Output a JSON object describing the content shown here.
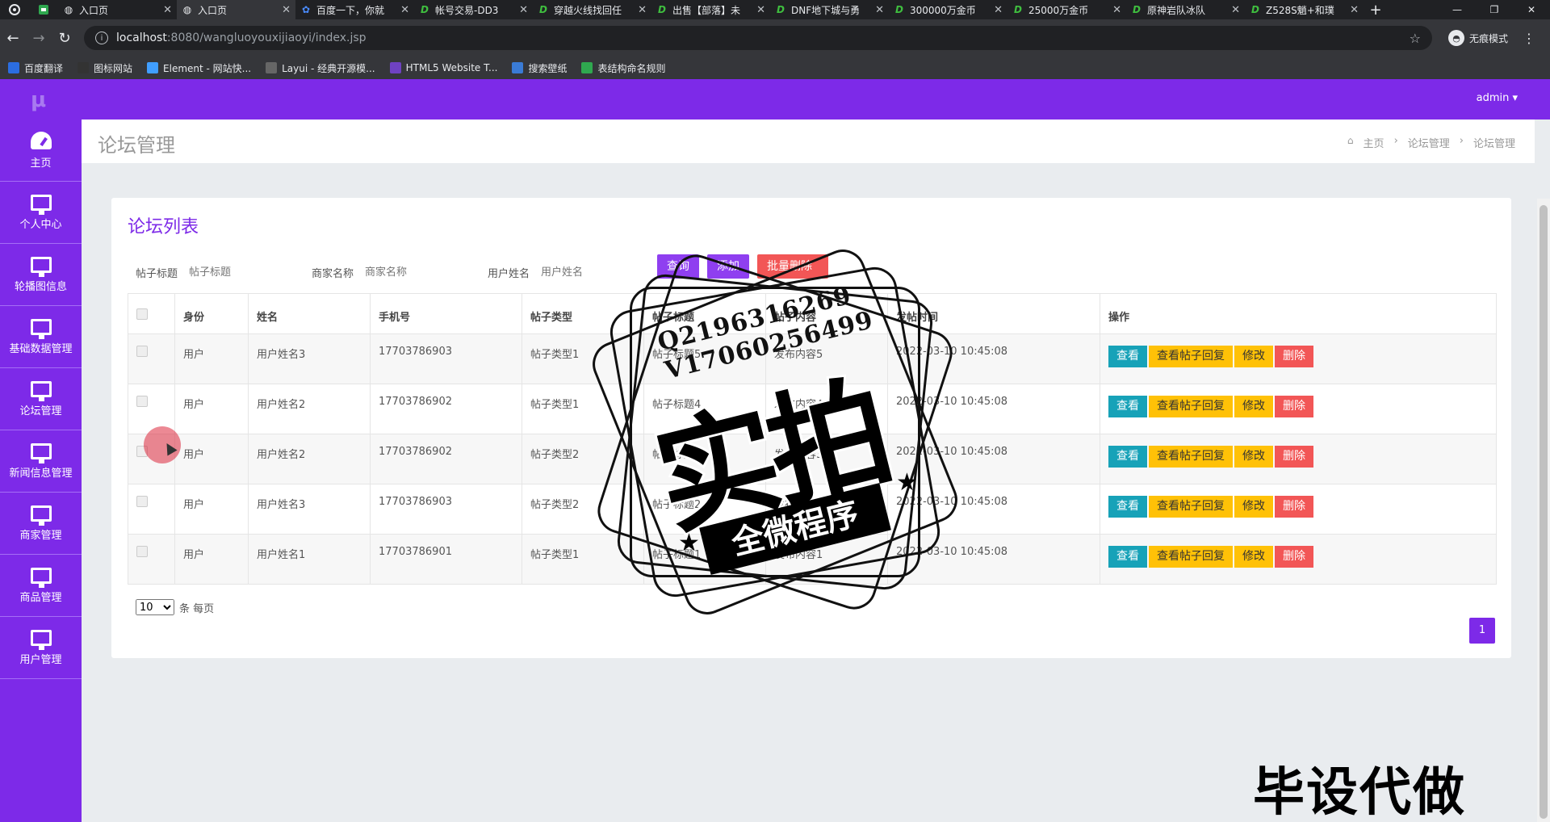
{
  "browser": {
    "tabs": [
      {
        "favicon": "globe-icon",
        "title": "入口页",
        "active": false
      },
      {
        "favicon": "globe-icon",
        "title": "入口页",
        "active": true
      },
      {
        "favicon": "paw-icon",
        "title": "百度一下，你就",
        "active": false
      },
      {
        "favicon": "d-icon",
        "title": "帐号交易-DD3",
        "active": false
      },
      {
        "favicon": "d-icon",
        "title": "穿越火线找回任",
        "active": false
      },
      {
        "favicon": "d-icon",
        "title": "出售【部落】未",
        "active": false
      },
      {
        "favicon": "d-icon",
        "title": "DNF地下城与勇",
        "active": false
      },
      {
        "favicon": "d-icon",
        "title": "300000万金币",
        "active": false
      },
      {
        "favicon": "d-icon",
        "title": "25000万金币",
        "active": false
      },
      {
        "favicon": "d-icon",
        "title": "原神岩队冰队",
        "active": false
      },
      {
        "favicon": "d-icon",
        "title": "Z528S魈+和璞",
        "active": false
      }
    ],
    "url_host": "localhost",
    "url_path": ":8080/wangluoyouxijiaoyi/index.jsp",
    "profile_label": "无痕模式",
    "bookmarks": [
      {
        "label": "百度翻译",
        "color": "#2b6de0"
      },
      {
        "label": "图标网站",
        "color": "#333333"
      },
      {
        "label": "Element - 网站快...",
        "color": "#409eff"
      },
      {
        "label": "Layui - 经典开源模...",
        "color": "#666666"
      },
      {
        "label": "HTML5 Website T...",
        "color": "#6f42c1"
      },
      {
        "label": "搜索壁纸",
        "color": "#3a7bd5"
      },
      {
        "label": "表结构命名规则",
        "color": "#2fa84f"
      }
    ]
  },
  "app": {
    "logo": "μ",
    "user": "admin ▾",
    "sidebar": [
      {
        "label": "主页",
        "icon": "dashboard-icon"
      },
      {
        "label": "个人中心",
        "icon": "monitor-icon"
      },
      {
        "label": "轮播图信息",
        "icon": "monitor-icon"
      },
      {
        "label": "基础数据管理",
        "icon": "monitor-icon"
      },
      {
        "label": "论坛管理",
        "icon": "monitor-icon"
      },
      {
        "label": "新闻信息管理",
        "icon": "monitor-icon"
      },
      {
        "label": "商家管理",
        "icon": "monitor-icon"
      },
      {
        "label": "商品管理",
        "icon": "monitor-icon"
      },
      {
        "label": "用户管理",
        "icon": "monitor-icon"
      }
    ],
    "page_title": "论坛管理",
    "breadcrumb": [
      "主页",
      "论坛管理",
      "论坛管理"
    ],
    "card_title": "论坛列表",
    "search": {
      "post_title_label": "帖子标题",
      "post_title_placeholder": "帖子标题",
      "merchant_label": "商家名称",
      "merchant_placeholder": "商家名称",
      "user_label": "用户姓名",
      "user_placeholder": "用户姓名",
      "query_button": "查询",
      "add_button": "添加",
      "batch_delete_button": "批量删除"
    },
    "table": {
      "headers": [
        "身份",
        "姓名",
        "手机号",
        "帖子类型",
        "帖子标题",
        "帖子内容",
        "发帖时间",
        "操作"
      ],
      "rows": [
        [
          "用户",
          "用户姓名3",
          "17703786903",
          "帖子类型1",
          "帖子标题5",
          "发布内容5",
          "2022-03-10 10:45:08"
        ],
        [
          "用户",
          "用户姓名2",
          "17703786902",
          "帖子类型1",
          "帖子标题4",
          "发布内容4",
          "2022-03-10 10:45:08"
        ],
        [
          "用户",
          "用户姓名2",
          "17703786902",
          "帖子类型2",
          "帖子标题3",
          "发布内容3",
          "2022-03-10 10:45:08"
        ],
        [
          "用户",
          "用户姓名3",
          "17703786903",
          "帖子类型2",
          "帖子标题2",
          "发布内容2",
          "2022-03-10 10:45:08"
        ],
        [
          "用户",
          "用户姓名1",
          "17703786901",
          "帖子类型1",
          "帖子标题1",
          "发布内容1",
          "2022-03-10 10:45:08"
        ]
      ],
      "actions": {
        "view": "查看",
        "reply": "查看帖子回复",
        "edit": "修改",
        "delete": "删除"
      }
    },
    "pager": {
      "page_size": "10",
      "page_size_suffix": "条 每页",
      "current_page": "1"
    }
  },
  "overlay": {
    "stamp_contact": [
      "Q2196316269",
      "V17060256499"
    ],
    "stamp_main": "实拍",
    "stamp_band": "全微程序",
    "bottom_watermark": "毕设代做"
  },
  "colors": {
    "brand": "#7d2ae8",
    "view": "#17a2b8",
    "warn": "#ffc107",
    "danger": "#f25656"
  }
}
